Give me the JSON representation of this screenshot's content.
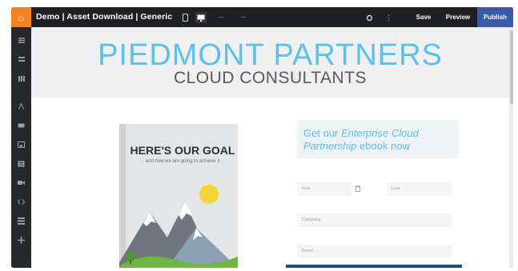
{
  "topbar": {
    "logo_glyph": "⌂",
    "title": "Demo | Asset Download | Generic",
    "icons": [
      "mobile-icon",
      "desktop-icon",
      "undo-icon",
      "redo-icon",
      "gear-icon",
      "more-icon"
    ],
    "save_label": "Save",
    "preview_label": "Preview",
    "publish_label": "Publish",
    "accent_color": "#f4831f",
    "publish_color": "#3a5aa8"
  },
  "sidebar": {
    "icons": [
      "sections-icon",
      "rows-icon",
      "columns-icon",
      "text-icon",
      "button-icon",
      "image-icon",
      "form-icon",
      "video-icon",
      "code-icon",
      "grid-icon",
      "add-icon"
    ]
  },
  "page": {
    "brand": "PIEDMONT PARTNERS",
    "tagline": "CLOUD CONSULTANTS",
    "brand_color": "#5cc0e8",
    "book": {
      "heading": "HERE'S OUR GOAL",
      "subheading": "and how we are going to achieve it"
    },
    "form": {
      "title_prefix": "Get our ",
      "title_emphasis": "Enterprise Cloud Partnership",
      "title_suffix": " ebook now",
      "fields": {
        "first": "First",
        "last": "Last",
        "company": "Company",
        "email": "Email"
      },
      "submit_color": "#1c4f86"
    }
  }
}
